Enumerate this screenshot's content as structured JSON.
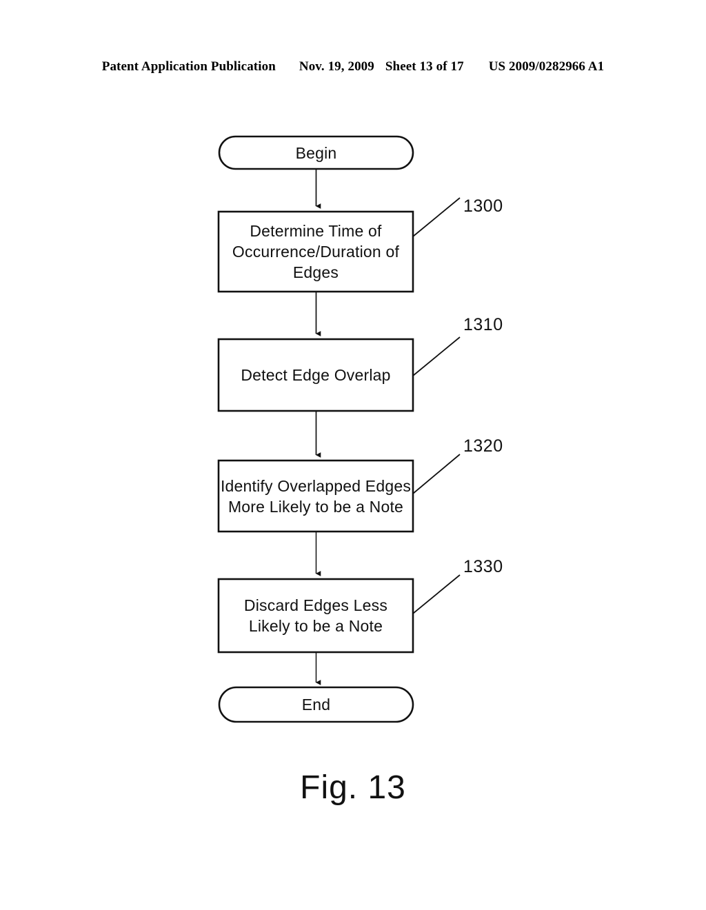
{
  "header": {
    "publication": "Patent Application Publication",
    "date": "Nov. 19, 2009",
    "sheet": "Sheet 13 of 17",
    "patent_number": "US 2009/0282966 A1"
  },
  "figure": {
    "caption": "Fig. 13",
    "ink_color": "#000000",
    "background_color": "#ffffff",
    "nodes": [
      {
        "id": "begin",
        "shape": "terminator",
        "label": "Begin"
      },
      {
        "id": "step-1300",
        "shape": "process",
        "label": "Determine Time of\nOccurrence/Duration of\nEdges",
        "ref": "1300"
      },
      {
        "id": "step-1310",
        "shape": "process",
        "label": "Detect Edge Overlap",
        "ref": "1310"
      },
      {
        "id": "step-1320",
        "shape": "process",
        "label": "Identify Overlapped Edges\nMore Likely to be a Note",
        "ref": "1320"
      },
      {
        "id": "step-1330",
        "shape": "process",
        "label": "Discard Edges Less\nLikely to be a Note",
        "ref": "1330"
      },
      {
        "id": "end",
        "shape": "terminator",
        "label": "End"
      }
    ],
    "reference_numerals": [
      {
        "value": "1300",
        "points_to": "step-1300"
      },
      {
        "value": "1310",
        "points_to": "step-1310"
      },
      {
        "value": "1320",
        "points_to": "step-1320"
      },
      {
        "value": "1330",
        "points_to": "step-1330"
      }
    ],
    "connectors": [
      {
        "from": "begin",
        "to": "step-1300",
        "arrow": "down"
      },
      {
        "from": "step-1300",
        "to": "step-1310",
        "arrow": "down"
      },
      {
        "from": "step-1310",
        "to": "step-1320",
        "arrow": "down"
      },
      {
        "from": "step-1320",
        "to": "step-1330",
        "arrow": "down"
      },
      {
        "from": "step-1330",
        "to": "end",
        "arrow": "down"
      }
    ]
  }
}
